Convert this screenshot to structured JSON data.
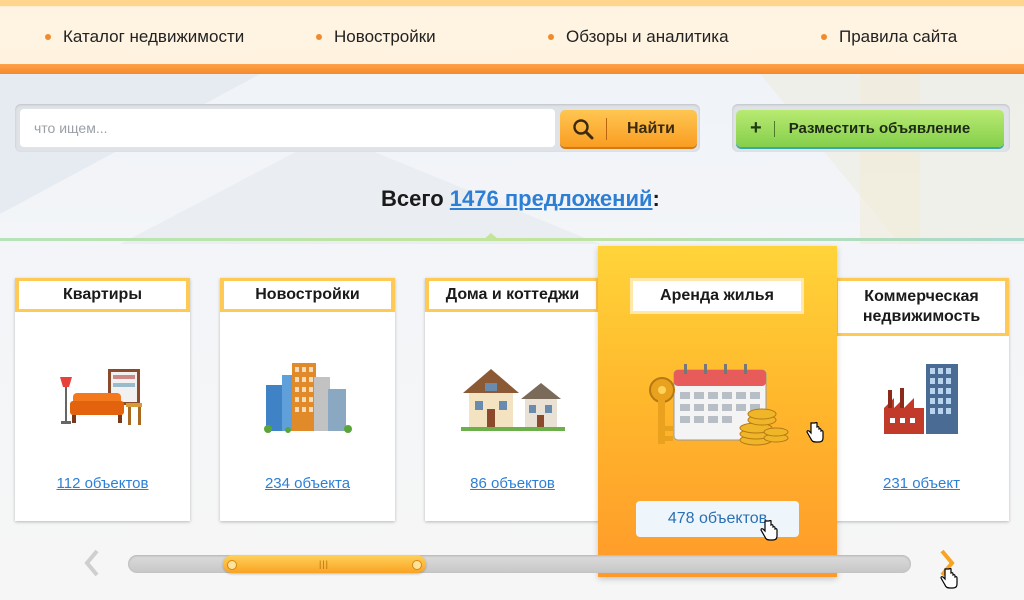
{
  "nav": {
    "items": [
      {
        "label": "Каталог недвижимости"
      },
      {
        "label": "Новостройки"
      },
      {
        "label": "Обзоры и аналитика"
      },
      {
        "label": "Правила сайта"
      }
    ]
  },
  "search": {
    "placeholder": "что ищем...",
    "value": "",
    "button_label": "Найти"
  },
  "post_ad": {
    "plus": "+",
    "label": "Разместить объявление"
  },
  "total": {
    "prefix": "Всего",
    "link": "1476 предложений",
    "suffix": ":"
  },
  "categories": [
    {
      "title": "Квартиры",
      "count": "112 объектов",
      "icon": "furniture-icon"
    },
    {
      "title": "Новостройки",
      "count": "234 объекта",
      "icon": "buildings-icon"
    },
    {
      "title": "Дома и коттеджи",
      "count": "86 объектов",
      "icon": "houses-icon"
    },
    {
      "title": "Аренда жилья",
      "count": "478 объектов",
      "icon": "calendar-key-coins-icon",
      "active": true
    },
    {
      "title_line1": "Коммерческая",
      "title_line2": "недвижимость",
      "count": "231 объект",
      "icon": "factory-office-icon"
    }
  ],
  "slider": {
    "position": 0.17,
    "prev": "chevron-left-icon",
    "next": "chevron-right-icon"
  },
  "colors": {
    "accent": "#f99d22",
    "link": "#2d7fd6",
    "green": "#84cf4b"
  }
}
